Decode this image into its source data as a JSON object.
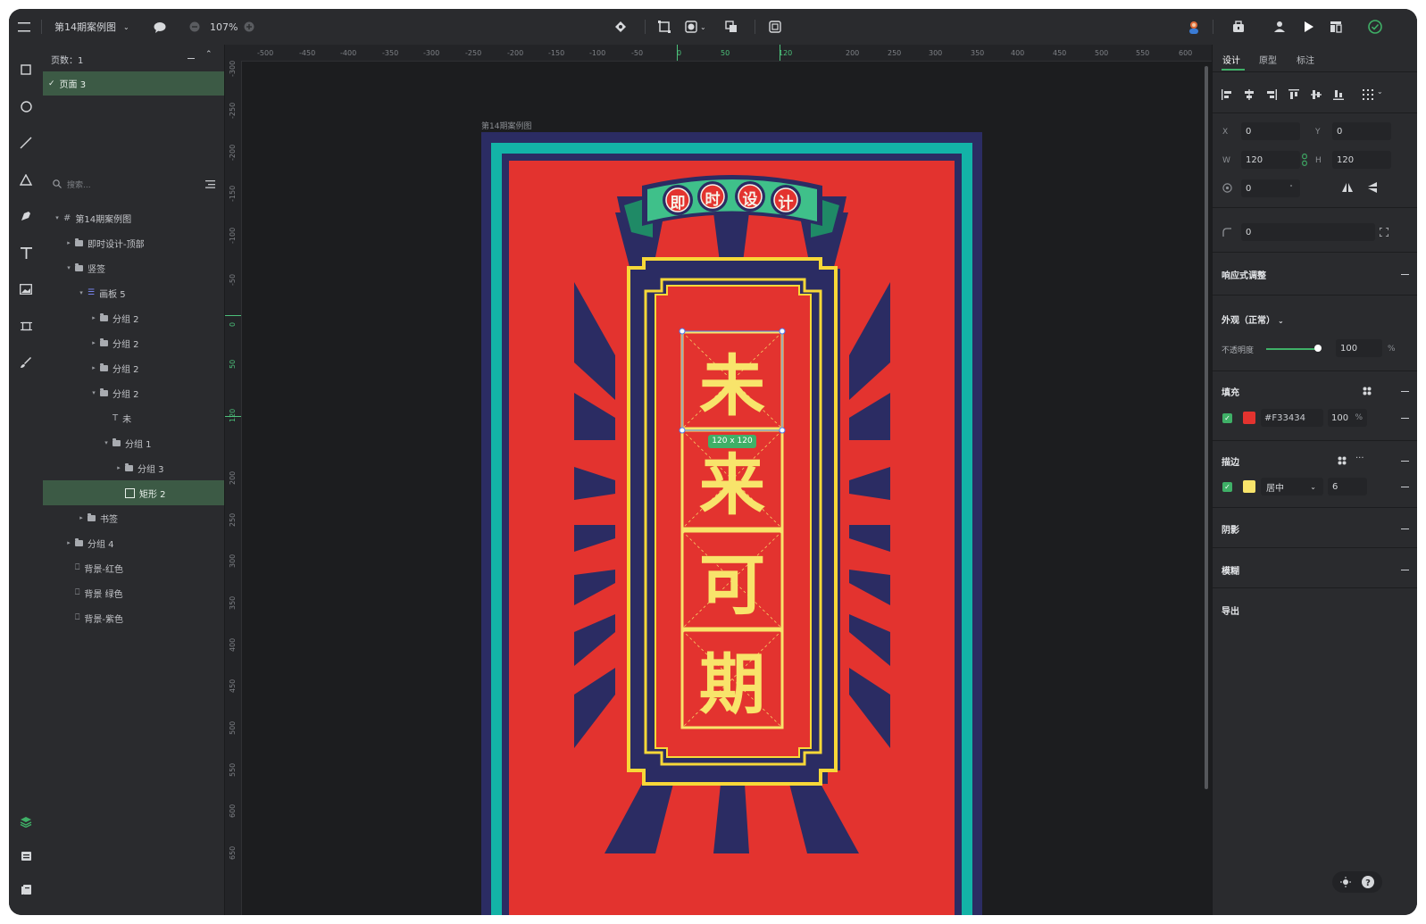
{
  "topbar": {
    "file_name": "第14期案例图",
    "zoom": "107%"
  },
  "layers": {
    "pages_label": "页数：1",
    "page_name": "页面 3",
    "search_placeholder": "搜索...",
    "tree": [
      {
        "label": "第14期案例图",
        "kind": "frame",
        "caret": "open"
      },
      {
        "label": "即时设计-顶部",
        "kind": "folder",
        "caret": "closed"
      },
      {
        "label": "竖签",
        "kind": "folder",
        "caret": "open"
      },
      {
        "label": "画板 5",
        "kind": "board",
        "caret": "open"
      },
      {
        "label": "分组 2",
        "kind": "folder",
        "caret": "closed"
      },
      {
        "label": "分组 2",
        "kind": "folder",
        "caret": "closed"
      },
      {
        "label": "分组 2",
        "kind": "folder",
        "caret": "closed"
      },
      {
        "label": "分组 2",
        "kind": "folder",
        "caret": "open"
      },
      {
        "label": "未",
        "kind": "text",
        "caret": "none"
      },
      {
        "label": "分组 1",
        "kind": "folder",
        "caret": "open"
      },
      {
        "label": "分组 3",
        "kind": "folder",
        "caret": "closed"
      },
      {
        "label": "矩形 2",
        "kind": "rect",
        "caret": "none",
        "selected": true
      },
      {
        "label": "书签",
        "kind": "folder",
        "caret": "closed"
      },
      {
        "label": "分组 4",
        "kind": "folder",
        "caret": "closed"
      },
      {
        "label": "背景-红色",
        "kind": "shape",
        "caret": "none"
      },
      {
        "label": "背景 绿色",
        "kind": "shape",
        "caret": "none"
      },
      {
        "label": "背景-紫色",
        "kind": "shape",
        "caret": "none"
      }
    ]
  },
  "canvas": {
    "frame_label": "第14期案例图",
    "selection_size": "120 x 120",
    "h_ruler": [
      "-500",
      "-450",
      "-400",
      "-350",
      "-300",
      "-250",
      "-200",
      "-150",
      "-100",
      "-50",
      "0",
      "50",
      "120",
      "200",
      "250",
      "300",
      "350",
      "400",
      "450",
      "500",
      "550",
      "600"
    ],
    "v_ruler": [
      "-300",
      "-250",
      "-200",
      "-150",
      "-100",
      "-50",
      "0",
      "50",
      "120",
      "200",
      "250",
      "300",
      "350",
      "400",
      "450",
      "500",
      "550",
      "600",
      "650"
    ],
    "banner_chars": [
      "即",
      "时",
      "设",
      "计"
    ],
    "main_chars": [
      "未",
      "来",
      "可",
      "期"
    ]
  },
  "inspector": {
    "tabs": [
      "设计",
      "原型",
      "标注"
    ],
    "x_label": "X",
    "x": "0",
    "y_label": "Y",
    "y": "0",
    "w_label": "W",
    "w": "120",
    "h_label": "H",
    "h": "120",
    "rotation": "0",
    "radius": "0",
    "responsive": "响应式调整",
    "appearance": "外观（正常）",
    "opacity_label": "不透明度",
    "opacity": "100",
    "opacity_unit": "%",
    "fill_title": "填充",
    "fill_hex": "#F33434",
    "fill_opacity": "100",
    "fill_unit": "%",
    "stroke_title": "描边",
    "stroke_position": "居中",
    "stroke_width": "6",
    "shadow_title": "阴影",
    "blur_title": "模糊",
    "export_title": "导出"
  },
  "colors": {
    "accent_green": "#3fb067",
    "fill_red": "#e3332f",
    "stroke_yellow": "#f8e46b",
    "navy": "#2b2c63",
    "teal": "#13b3a7",
    "selection_blue": "#4c7bf0"
  }
}
